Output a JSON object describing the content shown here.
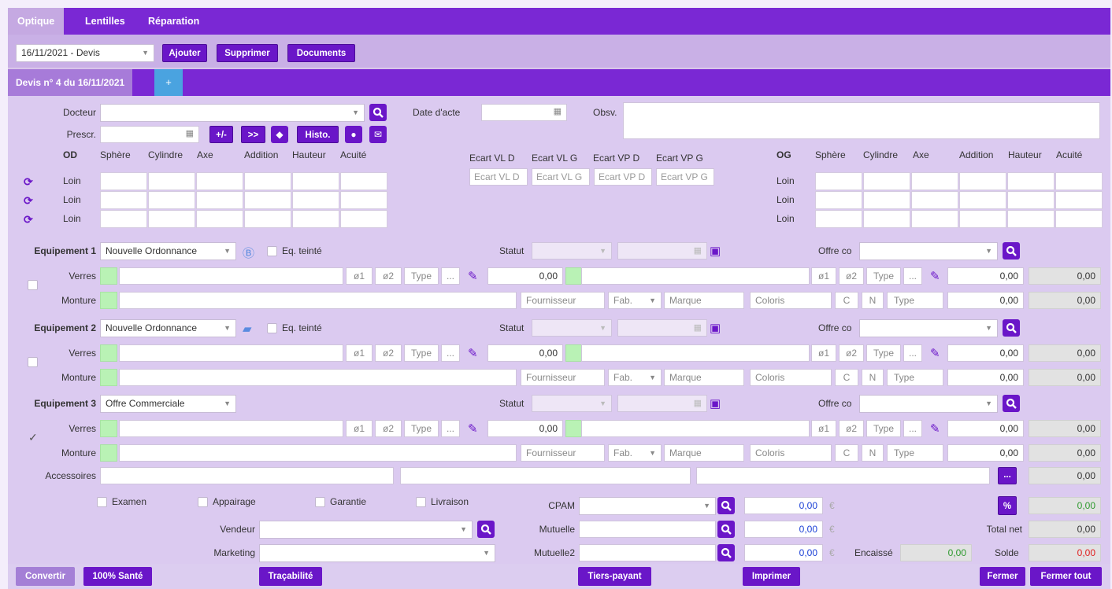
{
  "tabs": [
    "Optique",
    "Lentilles",
    "Réparation"
  ],
  "toolbar": {
    "quote_select": "16/11/2021 - Devis",
    "add": "Ajouter",
    "delete": "Supprimer",
    "documents": "Documents"
  },
  "quote_tab": "Devis n° 4 du 16/11/2021",
  "quote_add_icon": "plus-icon",
  "header": {
    "doctor_label": "Docteur",
    "prescr_label": "Prescr.",
    "act_date_label": "Date d'acte",
    "obs_label": "Obsv.",
    "btn_plusminus": "+/-",
    "btn_forward": ">>",
    "btn_histo": "Histo."
  },
  "prescription": {
    "od_label": "OD",
    "og_label": "OG",
    "columns": [
      "Sphère",
      "Cylindre",
      "Axe",
      "Addition",
      "Hauteur",
      "Acuité"
    ],
    "rows": [
      "Loin",
      "Loin",
      "Loin"
    ],
    "ecart_headers": [
      "Ecart VL D",
      "Ecart VL G",
      "Ecart VP D",
      "Ecart VP G"
    ],
    "ecart_placeholders": [
      "Ecart VL D",
      "Ecart VL G",
      "Ecart VP D",
      "Ecart VP G"
    ]
  },
  "equipements": [
    {
      "label": "Equipement 1",
      "type": "Nouvelle Ordonnance",
      "tinted": "Eq. teinté",
      "status_label": "Statut",
      "offer_label": "Offre co",
      "checked": false,
      "verres": {
        "label": "Verres",
        "o1": "ø1",
        "o2": "ø2",
        "type": "Type",
        "more": "...",
        "price_r": "0,00",
        "price_l": "0,00",
        "total": "0,00"
      },
      "monture": {
        "label": "Monture",
        "fournisseur": "Fournisseur",
        "fab": "Fab.",
        "marque": "Marque",
        "coloris": "Coloris",
        "c": "C",
        "n": "N",
        "type": "Type",
        "price": "0,00",
        "total": "0,00"
      }
    },
    {
      "label": "Equipement 2",
      "type": "Nouvelle Ordonnance",
      "tinted": "Eq. teinté",
      "status_label": "Statut",
      "offer_label": "Offre co",
      "checked": false,
      "verres": {
        "label": "Verres",
        "o1": "ø1",
        "o2": "ø2",
        "type": "Type",
        "more": "...",
        "price_r": "0,00",
        "price_l": "0,00",
        "total": "0,00"
      },
      "monture": {
        "label": "Monture",
        "fournisseur": "Fournisseur",
        "fab": "Fab.",
        "marque": "Marque",
        "coloris": "Coloris",
        "c": "C",
        "n": "N",
        "type": "Type",
        "price": "0,00",
        "total": "0,00"
      }
    },
    {
      "label": "Equipement 3",
      "type": "Offre Commerciale",
      "tinted": "",
      "status_label": "Statut",
      "offer_label": "Offre co",
      "checked": true,
      "verres": {
        "label": "Verres",
        "o1": "ø1",
        "o2": "ø2",
        "type": "Type",
        "more": "...",
        "price_r": "0,00",
        "price_l": "0,00",
        "total": "0,00"
      },
      "monture": {
        "label": "Monture",
        "fournisseur": "Fournisseur",
        "fab": "Fab.",
        "marque": "Marque",
        "coloris": "Coloris",
        "c": "C",
        "n": "N",
        "type": "Type",
        "price": "0,00",
        "total": "0,00"
      }
    }
  ],
  "accessoires": {
    "label": "Accessoires",
    "more": "...",
    "total": "0,00"
  },
  "options": [
    "Examen",
    "Appairage",
    "Garantie",
    "Livraison"
  ],
  "vendeur_label": "Vendeur",
  "marketing_label": "Marketing",
  "payers": [
    {
      "label": "CPAM",
      "amount": "0,00",
      "currency": "€"
    },
    {
      "label": "Mutuelle",
      "amount": "0,00",
      "currency": "€"
    },
    {
      "label": "Mutuelle2",
      "amount": "0,00",
      "currency": "€"
    }
  ],
  "totals": {
    "percent_btn": "%",
    "percent_value": "0,00",
    "total_net_label": "Total net",
    "total_net": "0,00",
    "encaisse_label": "Encaissé",
    "encaisse": "0,00",
    "solde_label": "Solde",
    "solde": "0,00"
  },
  "footer": {
    "convertir": "Convertir",
    "sante": "100% Santé",
    "tracabilite": "Traçabilité",
    "tiers_payant": "Tiers-payant",
    "imprimer": "Imprimer",
    "fermer": "Fermer",
    "fermer_tout": "Fermer tout"
  },
  "colors": {
    "primary": "#7a28d4",
    "button": "#6a16c8",
    "background": "#dbcaf0",
    "green_value": "#2e9a2e",
    "red_value": "#e02020",
    "blue_value": "#1a3fd6"
  }
}
